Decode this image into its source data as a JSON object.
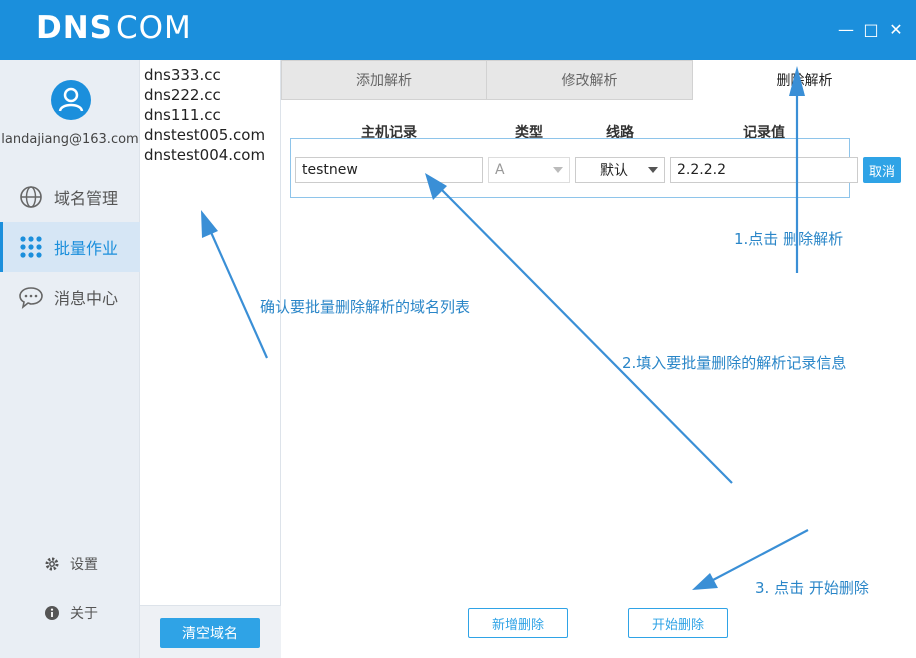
{
  "app": {
    "logo_bold": "DNS",
    "logo_thin": "COM",
    "window_controls": [
      "—",
      "□",
      "✕"
    ]
  },
  "sidebar": {
    "email": "landajiang@163.com",
    "nav": [
      {
        "label": "域名管理",
        "icon": "globe-icon"
      },
      {
        "label": "批量作业",
        "icon": "grid-icon"
      },
      {
        "label": "消息中心",
        "icon": "chat-icon"
      }
    ],
    "settings_label": "设置",
    "about_label": "关于"
  },
  "domains": {
    "items": [
      "dns333.cc",
      "dns222.cc",
      "dns111.cc",
      "dnstest005.com",
      "dnstest004.com"
    ],
    "clear_label": "清空域名"
  },
  "tabs": [
    {
      "label": "添加解析"
    },
    {
      "label": "修改解析"
    },
    {
      "label": "删除解析"
    }
  ],
  "record": {
    "headers": {
      "host": "主机记录",
      "type": "类型",
      "line": "线路",
      "value": "记录值"
    },
    "host_value": "testnew",
    "type_value": "A",
    "line_value": "默认",
    "record_value": "2.2.2.2",
    "cancel_label": "取消"
  },
  "actions": {
    "add_delete_label": "新增删除",
    "start_delete_label": "开始删除"
  },
  "annotations": {
    "step1": "1.点击 删除解析",
    "domains_note": "确认要批量删除解析的域名列表",
    "step2": "2.填入要批量删除的解析记录信息",
    "step3": "3. 点击 开始删除"
  },
  "colors": {
    "brand": "#1b8fdc",
    "accent": "#2fa3e6",
    "arrow": "#3a8fd6"
  }
}
